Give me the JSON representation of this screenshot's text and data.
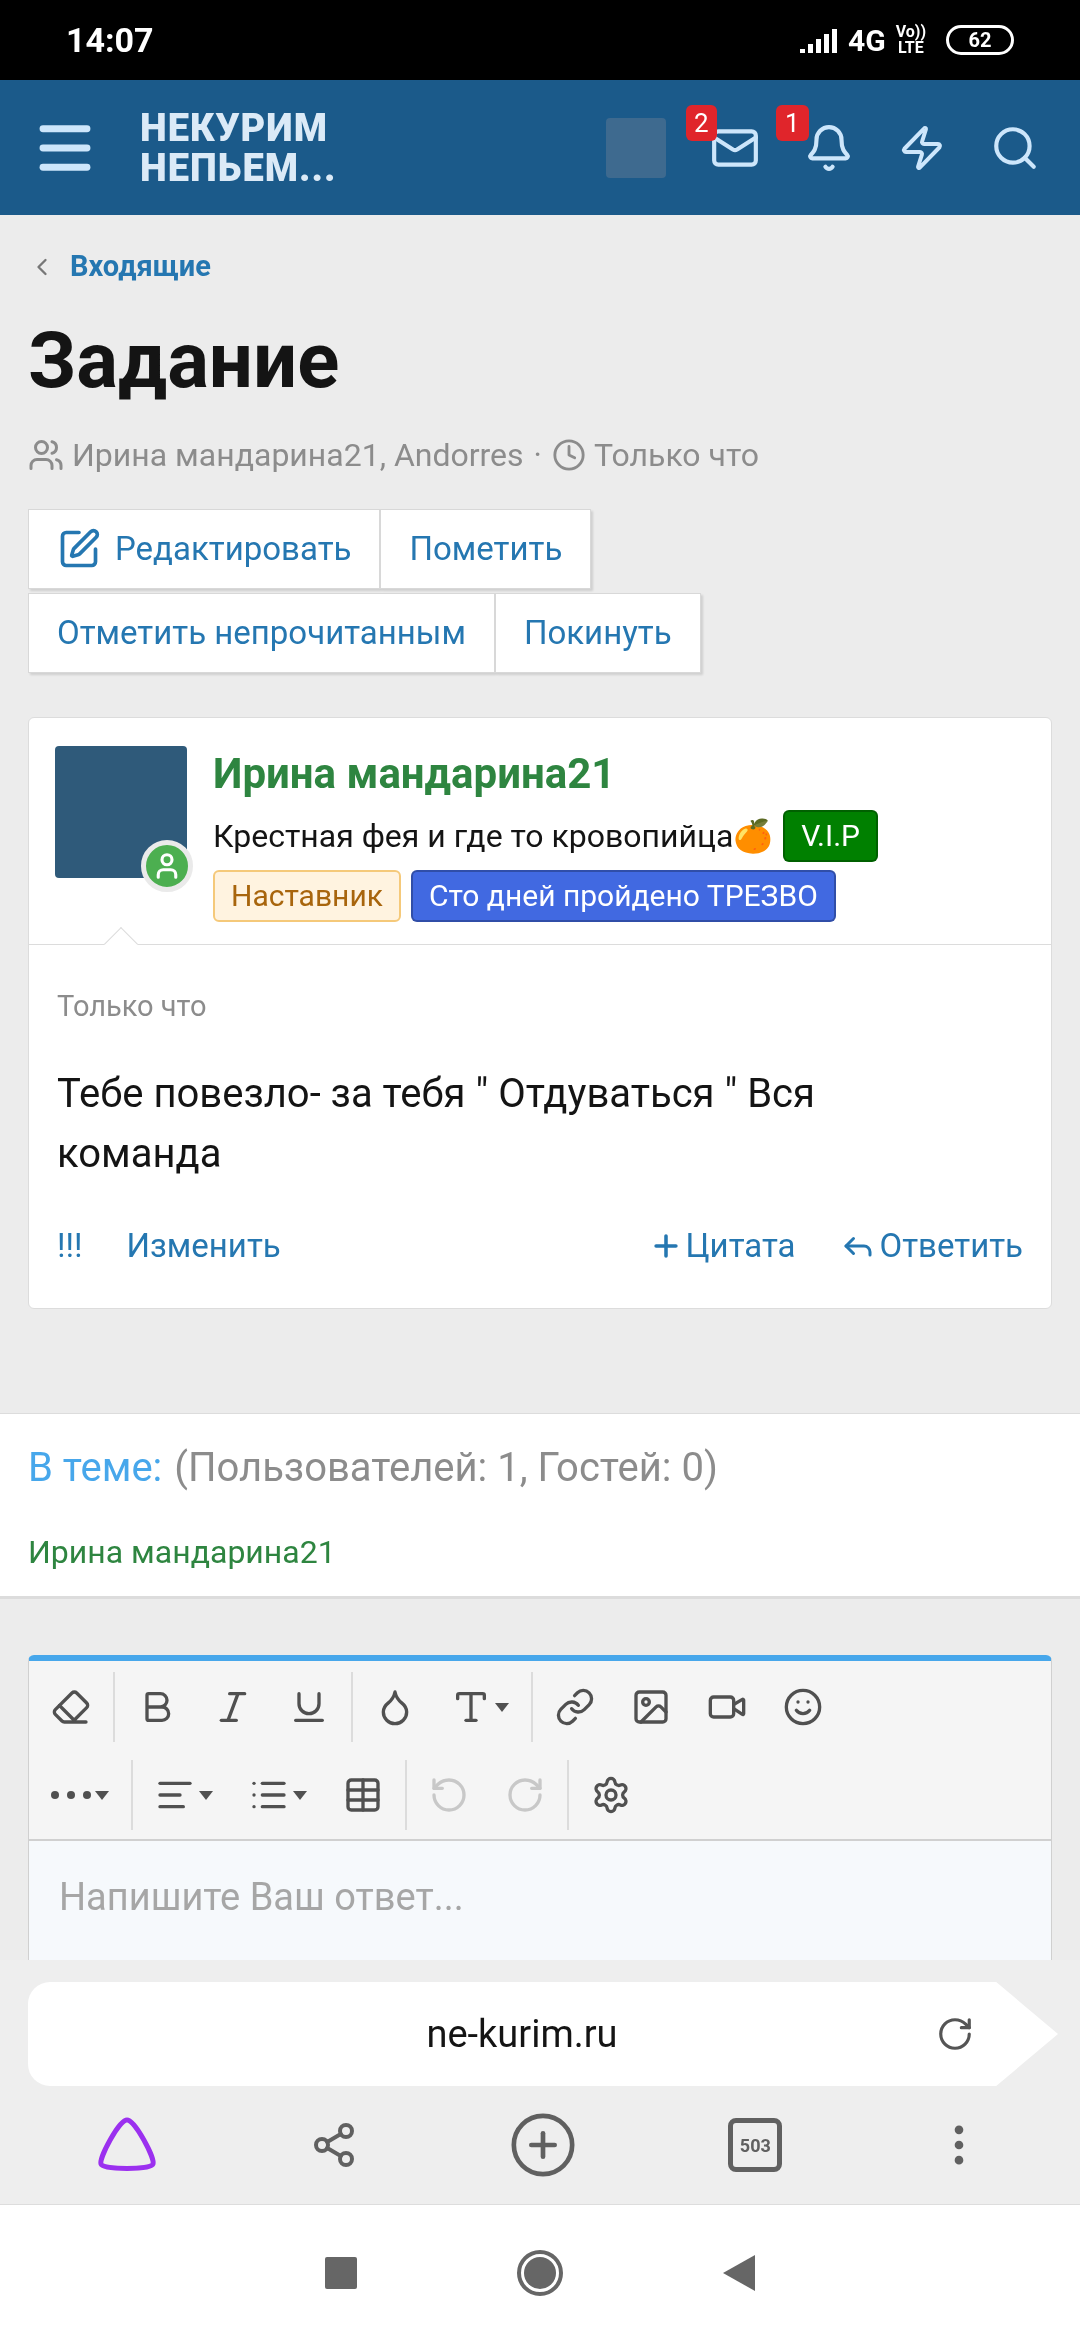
{
  "status_bar": {
    "time": "14:07",
    "network": "4G",
    "volte": [
      "Vo))",
      "LTE"
    ],
    "battery": "62"
  },
  "header": {
    "logo": [
      "НЕКУРИМ",
      "НЕПЬЕМ..."
    ],
    "mail_count": "2",
    "alert_count": "1"
  },
  "breadcrumb": "Входящие",
  "title": "Задание",
  "meta": {
    "participants": "Ирина мандарина21, Andorres",
    "separator": "·",
    "time": "Только что"
  },
  "actions": [
    [
      "Редактировать",
      "Пометить"
    ],
    [
      "Отметить непрочитанным",
      "Покинуть"
    ]
  ],
  "message": {
    "author": "Ирина мандарина21",
    "online": true,
    "user_title": "Крестная фея и где то кровопийца🍊",
    "badges": [
      {
        "label": "V.I.P",
        "color": "#008000"
      },
      {
        "label": "Наставник",
        "color": "#fff3e0"
      },
      {
        "label": "Сто дней пройдено ТРЕЗВО",
        "color": "#4169e1"
      }
    ],
    "time": "Только что",
    "text": "Тебе повезло- за тебя \" Отдуваться \" Вся команда",
    "left_actions": [
      "!!!",
      "Изменить"
    ],
    "quote": "Цитата",
    "reply": "Ответить"
  },
  "in_topic": {
    "label": "В теме:",
    "counts": "(Пользователей: 1, Гостей: 0)",
    "users": [
      "Ирина мандарина21"
    ]
  },
  "editor": {
    "undo_disabled": true,
    "redo_disabled": true,
    "placeholder": "Напишите Ваш ответ..."
  },
  "browser": {
    "url": "ne-kurim.ru",
    "tabs_count": "503"
  }
}
